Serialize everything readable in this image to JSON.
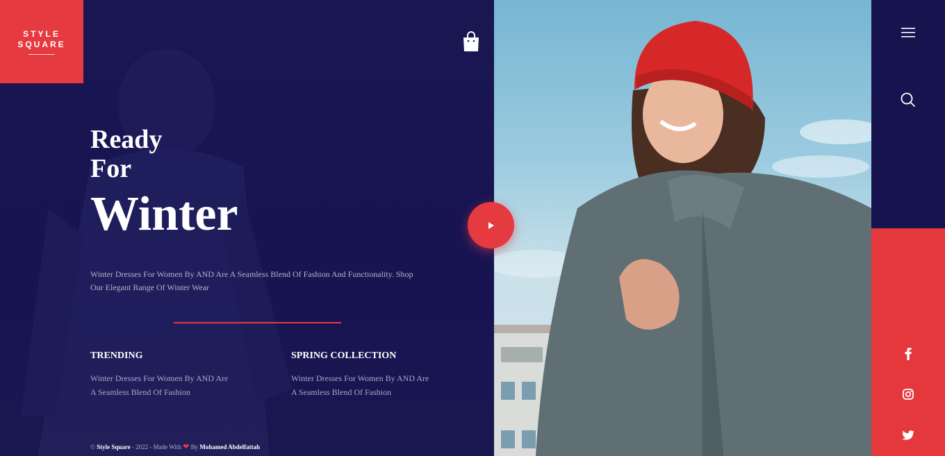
{
  "brand": {
    "line1": "STYLE",
    "line2": "SQUARE"
  },
  "hero": {
    "line1": "Ready",
    "line2": "For",
    "line3": "Winter",
    "description": "Winter Dresses For Women By AND Are A Seamless Blend Of Fashion And Functionality. Shop Our Elegant Range Of Winter Wear"
  },
  "features": [
    {
      "title": "TRENDING",
      "text": "Winter Dresses For Women By AND Are A Seamless Blend Of Fashion"
    },
    {
      "title": "SPRING COLLECTION",
      "text": "Winter Dresses For Women By AND Are A Seamless Blend Of Fashion"
    }
  ],
  "footer": {
    "copyright": "© ",
    "site": "Style Square",
    "middle": " - 2022 - Made With ",
    "by": " By ",
    "author": "Mohamed Abdelfattah"
  },
  "icons": {
    "cart": "shopping-bag-icon",
    "play": "play-icon",
    "menu": "hamburger-menu-icon",
    "search": "search-icon",
    "facebook": "facebook-icon",
    "instagram": "instagram-icon",
    "twitter": "twitter-icon"
  },
  "colors": {
    "accent": "#e53a3f",
    "navy": "#16134f",
    "text_muted": "#b4b3c9"
  }
}
